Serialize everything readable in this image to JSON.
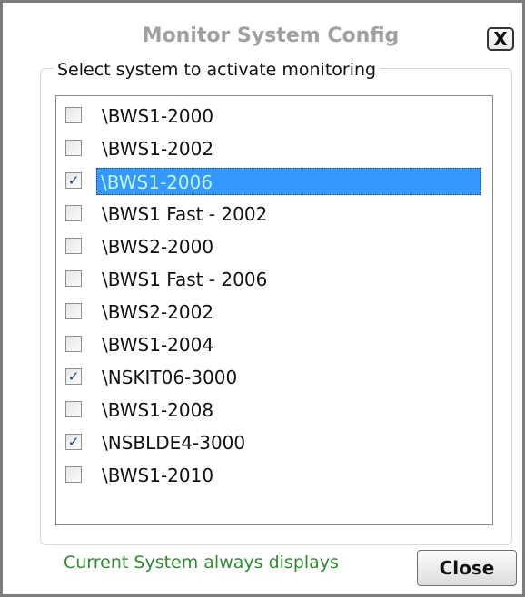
{
  "dialog": {
    "title": "Monitor System Config",
    "close_icon": "close-x-icon",
    "close_glyph": "X"
  },
  "group": {
    "label": "Select system to activate monitoring"
  },
  "systems": [
    {
      "label": "\\BWS1-2000",
      "checked": false,
      "selected": false
    },
    {
      "label": "\\BWS1-2002",
      "checked": false,
      "selected": false
    },
    {
      "label": "\\BWS1-2006",
      "checked": true,
      "selected": true
    },
    {
      "label": "\\BWS1 Fast - 2002",
      "checked": false,
      "selected": false
    },
    {
      "label": "\\BWS2-2000",
      "checked": false,
      "selected": false
    },
    {
      "label": "\\BWS1 Fast - 2006",
      "checked": false,
      "selected": false
    },
    {
      "label": "\\BWS2-2002",
      "checked": false,
      "selected": false
    },
    {
      "label": "\\BWS1-2004",
      "checked": false,
      "selected": false
    },
    {
      "label": "\\NSKIT06-3000",
      "checked": true,
      "selected": false
    },
    {
      "label": "\\BWS1-2008",
      "checked": false,
      "selected": false
    },
    {
      "label": "\\NSBLDE4-3000",
      "checked": true,
      "selected": false
    },
    {
      "label": "\\BWS1-2010",
      "checked": false,
      "selected": false
    }
  ],
  "footer": {
    "status": "Current System always displays",
    "close_label": "Close"
  },
  "colors": {
    "selection_bg": "#3399ff",
    "selection_text": "#bff5e6",
    "status_text": "#2f8a2f",
    "title_text": "#a0a0a0"
  }
}
